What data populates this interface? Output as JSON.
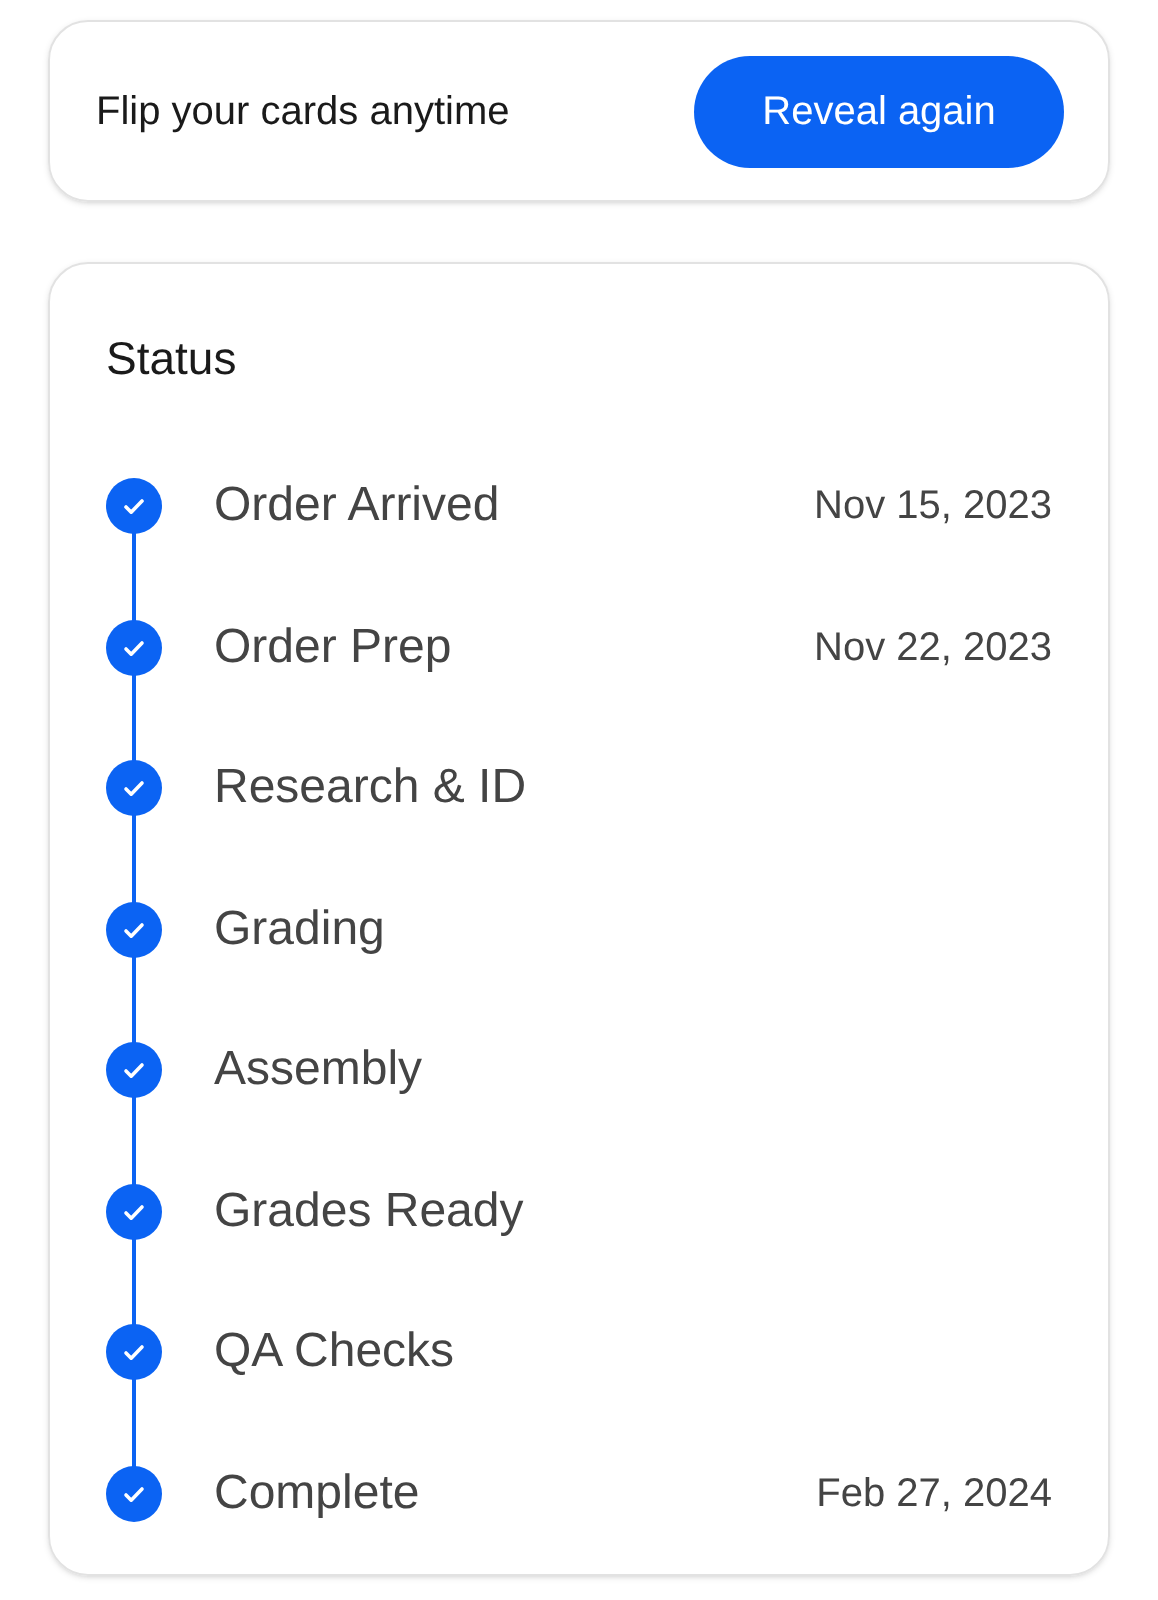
{
  "banner": {
    "text": "Flip your cards anytime",
    "button": "Reveal again"
  },
  "status": {
    "title": "Status",
    "steps": [
      {
        "label": "Order Arrived",
        "date": "Nov 15, 2023",
        "done": true
      },
      {
        "label": "Order Prep",
        "date": "Nov 22, 2023",
        "done": true
      },
      {
        "label": "Research & ID",
        "done": true
      },
      {
        "label": "Grading",
        "done": true
      },
      {
        "label": "Assembly",
        "done": true
      },
      {
        "label": "Grades Ready",
        "done": true
      },
      {
        "label": "QA Checks",
        "done": true
      },
      {
        "label": "Complete",
        "date": "Feb 27, 2024",
        "done": true
      }
    ]
  }
}
